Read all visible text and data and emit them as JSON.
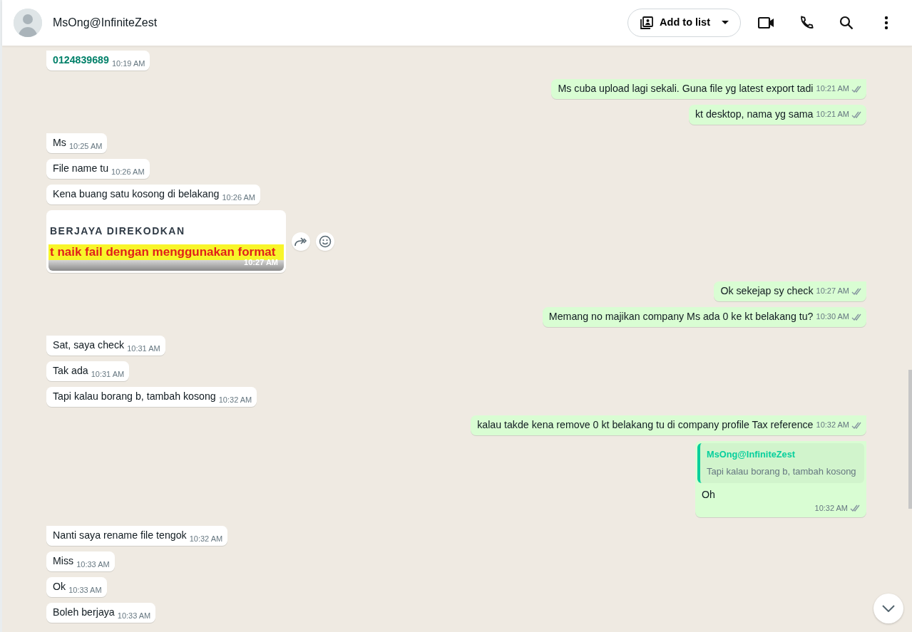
{
  "header": {
    "contact_name": "MsOng@InfiniteZest",
    "add_to_list_button": "Add to list"
  },
  "messages": [
    {
      "kind": "phone",
      "outgoing": false,
      "text": "0124839689",
      "time": "10:19 AM"
    },
    {
      "kind": "text",
      "outgoing": true,
      "text": "Ms cuba upload lagi sekali. Guna file yg latest export tadi",
      "time": "10:21 AM",
      "read": false
    },
    {
      "kind": "text",
      "outgoing": true,
      "text": "kt desktop, nama yg sama",
      "time": "10:21 AM",
      "read": false
    },
    {
      "kind": "text",
      "outgoing": false,
      "text": "Ms",
      "time": "10:25 AM"
    },
    {
      "kind": "text",
      "outgoing": false,
      "text": "File name tu",
      "time": "10:26 AM"
    },
    {
      "kind": "text",
      "outgoing": false,
      "text": "Kena buang satu kosong di belakang",
      "time": "10:26 AM"
    },
    {
      "kind": "image",
      "outgoing": false,
      "image_heading": "BERJAYA DIREKODKAN",
      "image_banner": "t naik fail dengan menggunakan format",
      "time": "10:27 AM"
    },
    {
      "kind": "text",
      "outgoing": true,
      "text": "Ok sekejap sy check",
      "time": "10:27 AM",
      "read": false
    },
    {
      "kind": "text",
      "outgoing": true,
      "text": "Memang no majikan company Ms ada 0 ke kt belakang tu?",
      "time": "10:30 AM",
      "read": false
    },
    {
      "kind": "text",
      "outgoing": false,
      "text": "Sat, saya check",
      "time": "10:31 AM"
    },
    {
      "kind": "text",
      "outgoing": false,
      "text": "Tak ada",
      "time": "10:31 AM"
    },
    {
      "kind": "text",
      "outgoing": false,
      "text": "Tapi kalau borang b, tambah kosong",
      "time": "10:32 AM"
    },
    {
      "kind": "text",
      "outgoing": true,
      "text": "kalau takde kena remove 0 kt belakang tu di company profile Tax reference",
      "time": "10:32 AM",
      "read": false
    },
    {
      "kind": "reply",
      "outgoing": true,
      "quote_author": "MsOng@InfiniteZest",
      "quote_text": "Tapi kalau borang b, tambah kosong",
      "text": "Oh",
      "time": "10:32 AM",
      "read": false
    },
    {
      "kind": "text",
      "outgoing": false,
      "text": "Nanti saya rename file tengok",
      "time": "10:32 AM"
    },
    {
      "kind": "text",
      "outgoing": false,
      "text": "Miss",
      "time": "10:33 AM"
    },
    {
      "kind": "text",
      "outgoing": false,
      "text": "Ok",
      "time": "10:33 AM"
    },
    {
      "kind": "text",
      "outgoing": false,
      "text": "Boleh berjaya",
      "time": "10:33 AM"
    }
  ]
}
